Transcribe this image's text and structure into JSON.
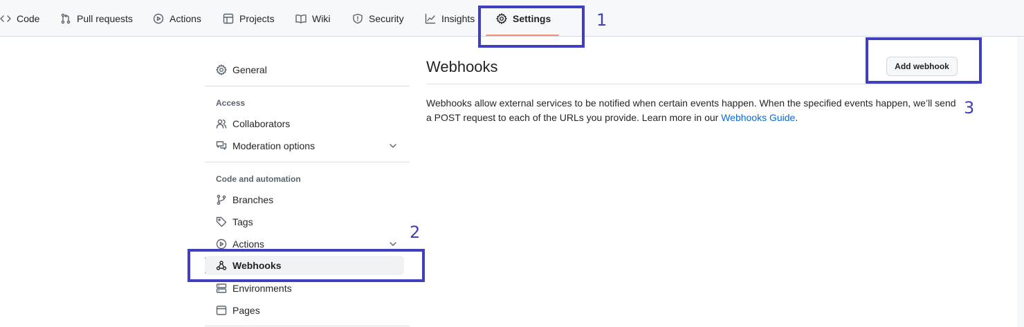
{
  "topnav": {
    "tabs": [
      {
        "label": "Code",
        "icon": "code-icon"
      },
      {
        "label": "Pull requests",
        "icon": "pull-request-icon"
      },
      {
        "label": "Actions",
        "icon": "play-icon"
      },
      {
        "label": "Projects",
        "icon": "table-icon"
      },
      {
        "label": "Wiki",
        "icon": "book-icon"
      },
      {
        "label": "Security",
        "icon": "shield-icon"
      },
      {
        "label": "Insights",
        "icon": "graph-icon"
      },
      {
        "label": "Settings",
        "icon": "gear-icon",
        "active": true
      }
    ]
  },
  "sidebar": {
    "general": "General",
    "access_heading": "Access",
    "collaborators": "Collaborators",
    "moderation": "Moderation options",
    "code_heading": "Code and automation",
    "branches": "Branches",
    "tags": "Tags",
    "actions": "Actions",
    "webhooks": "Webhooks",
    "environments": "Environments",
    "pages": "Pages"
  },
  "main": {
    "title": "Webhooks",
    "add_button": "Add webhook",
    "description": "Webhooks allow external services to be notified when certain events happen. When the specified events happen, we’ll send a POST request to each of the URLs you provide. Learn more in our ",
    "guide_link": "Webhooks Guide",
    "description_end": "."
  },
  "annotations": {
    "one": "1",
    "two": "2",
    "three": "3",
    "color": "#3f3fbf"
  },
  "colors": {
    "accent": "#0969da",
    "tab_underline": "#fd8c73"
  }
}
